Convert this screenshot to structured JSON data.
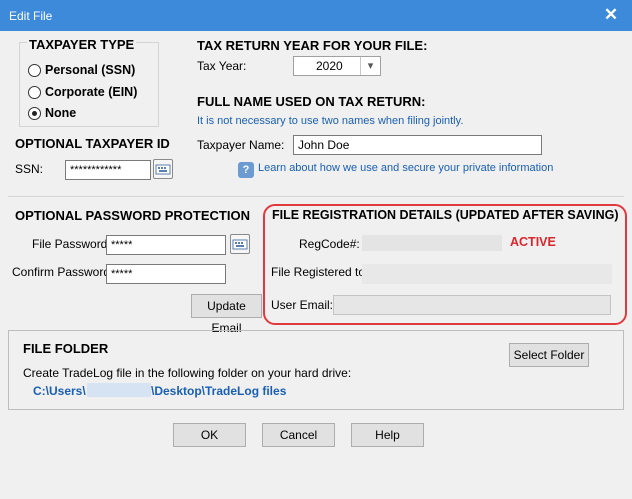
{
  "window": {
    "title": "Edit File",
    "close_symbol": "✕"
  },
  "taxpayer_type": {
    "heading": "TAXPAYER TYPE",
    "options": [
      "Personal (SSN)",
      "Corporate (EIN)",
      "None"
    ],
    "selected": "None"
  },
  "tax_return_year": {
    "heading": "TAX RETURN YEAR FOR YOUR FILE:",
    "label": "Tax Year:",
    "value": "2020",
    "dropdown_symbol": "▾"
  },
  "full_name": {
    "heading": "FULL NAME USED ON TAX RETURN:",
    "note": "It is not necessary to use two names when filing jointly.",
    "label": "Taxpayer Name:",
    "value": "John Doe"
  },
  "optional_taxpayer_id": {
    "heading": "OPTIONAL TAXPAYER ID",
    "label": "SSN:",
    "value": "************"
  },
  "privacy_link": {
    "text": "Learn about how we use and secure your private information",
    "icon_symbol": "?"
  },
  "password": {
    "heading": "OPTIONAL PASSWORD PROTECTION",
    "file_password_label": "File Password:",
    "file_password_value": "*****",
    "confirm_label": "Confirm Password:",
    "confirm_value": "*****",
    "update_button": "Update Email"
  },
  "registration": {
    "heading": "FILE REGISTRATION DETAILS (UPDATED AFTER SAVING)",
    "regcode_label": "RegCode#:",
    "status": "ACTIVE",
    "registered_to_label": "File Registered to:",
    "email_label": "User Email:",
    "highlight_color": "#e0393e"
  },
  "folder": {
    "heading": "FILE FOLDER",
    "instruction": "Create TradeLog file in the following folder on your hard drive:",
    "path_prefix": "C:\\Users\\",
    "path_suffix": "\\Desktop\\TradeLog files",
    "select_button": "Select Folder"
  },
  "buttons": {
    "ok": "OK",
    "cancel": "Cancel",
    "help": "Help"
  },
  "colors": {
    "titlebar": "#3c8ad9",
    "link": "#1a5fb4",
    "active": "#d9262d"
  }
}
